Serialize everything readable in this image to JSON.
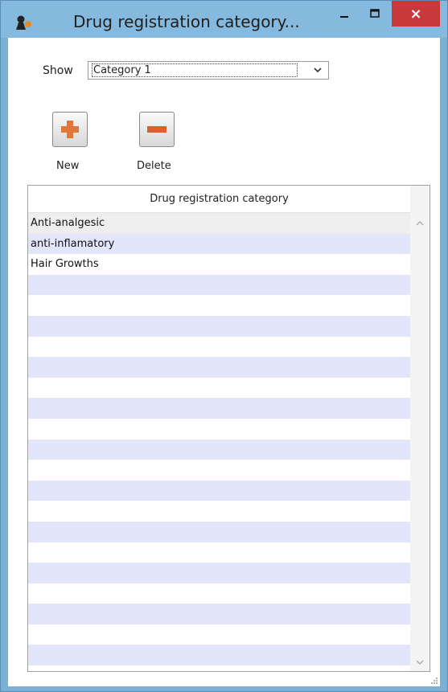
{
  "window": {
    "title": "Drug registration category...",
    "close_glyph": "×"
  },
  "filter": {
    "label": "Show",
    "selected": "Category 1"
  },
  "toolbar": {
    "new_label": "New",
    "delete_label": "Delete"
  },
  "table": {
    "column_header": "Drug registration category",
    "rows": [
      "Anti-analgesic",
      "anti-inflamatory",
      "Hair Growths",
      "",
      "",
      "",
      "",
      "",
      "",
      "",
      "",
      "",
      "",
      "",
      "",
      "",
      "",
      "",
      "",
      "",
      "",
      ""
    ],
    "row_colors": [
      "#eeeeee",
      "#e3e6fa",
      "#ffffff"
    ]
  },
  "colors": {
    "title_bar": "#86b9de",
    "close_button": "#c7393a",
    "accent_orange": "#e2773a"
  }
}
